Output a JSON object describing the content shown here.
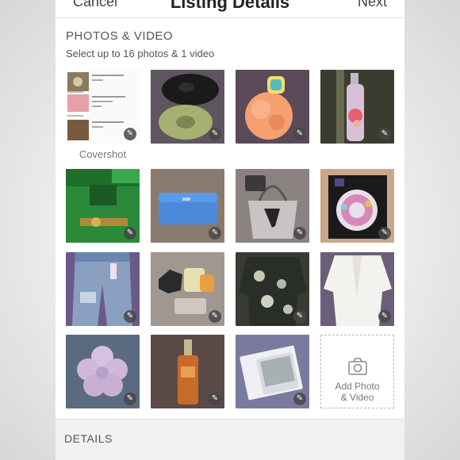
{
  "header": {
    "cancel_label": "Cancel",
    "title": "Listing Details",
    "next_label": "Next"
  },
  "photos": {
    "section_title": "PHOTOS & VIDEO",
    "subtitle": "Select up to 16 photos & 1 video",
    "covershot_label": "Covershot",
    "add_label_line1": "Add Photo",
    "add_label_line2": "& Video",
    "tiles": [
      {
        "subject": "listing screenshot"
      },
      {
        "subject": "scrunchies"
      },
      {
        "subject": "orange bath sponge"
      },
      {
        "subject": "body spray bottle"
      },
      {
        "subject": "green open me box"
      },
      {
        "subject": "blue wallet"
      },
      {
        "subject": "clear tote bag"
      },
      {
        "subject": "press-on nails"
      },
      {
        "subject": "denim shorts"
      },
      {
        "subject": "small toys"
      },
      {
        "subject": "floral blouse"
      },
      {
        "subject": "white cardigan"
      },
      {
        "subject": "flower hair clip"
      },
      {
        "subject": "serum bottle"
      },
      {
        "subject": "writing tablet"
      }
    ]
  },
  "details": {
    "section_title": "DETAILS"
  }
}
